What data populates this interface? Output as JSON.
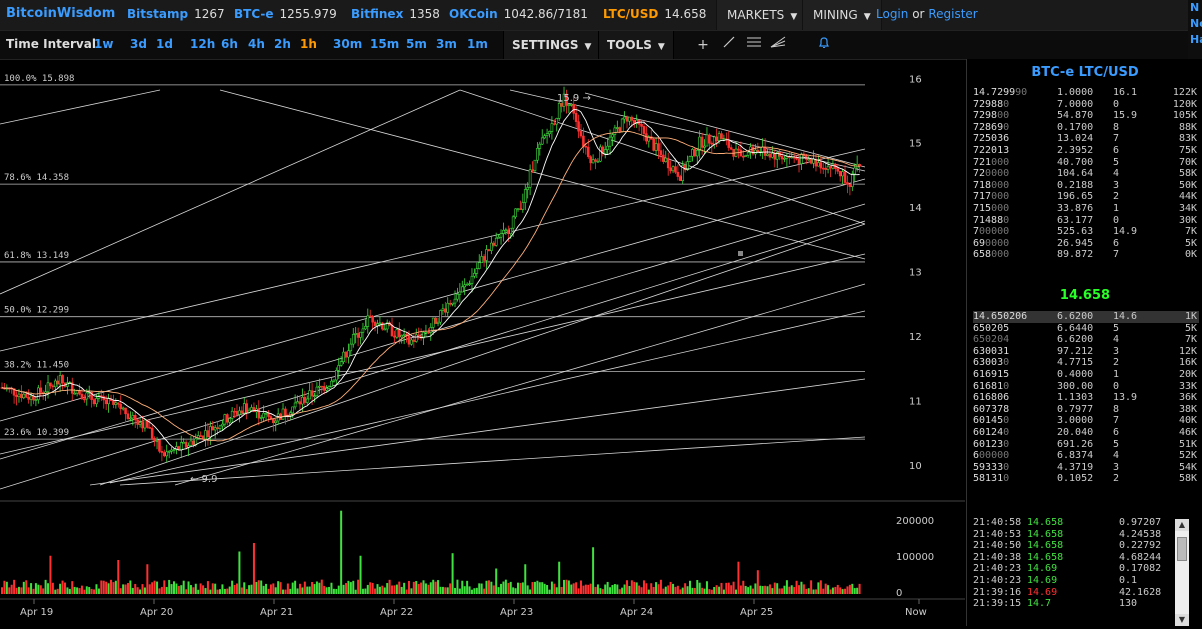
{
  "header": {
    "brand": "BitcoinWisdom",
    "tickers": [
      {
        "name": "Bitstamp",
        "value": "1267"
      },
      {
        "name": "BTC-e",
        "value": "1255.979"
      },
      {
        "name": "Bitfinex",
        "value": "1358"
      },
      {
        "name": "OKCoin",
        "value": "1042.86/7181"
      },
      {
        "name": "LTC/USD",
        "value": "14.658"
      }
    ],
    "markets_label": "MARKETS",
    "mining_label": "MINING",
    "login_label": "Login",
    "or_label": "or",
    "register_label": "Register",
    "edge_labels": [
      "N",
      "Ne",
      "Ha"
    ]
  },
  "toolbar": {
    "time_interval_label": "Time Interval:",
    "intervals": [
      "1w",
      "3d",
      "1d",
      "12h",
      "6h",
      "4h",
      "2h",
      "1h",
      "30m",
      "15m",
      "5m",
      "3m",
      "1m"
    ],
    "active_interval": "1h",
    "settings_label": "SETTINGS",
    "tools_label": "TOOLS"
  },
  "chart_data": {
    "type": "candlestick",
    "price_axis": {
      "min": 9.5,
      "max": 16.3,
      "ticks": [
        10,
        11,
        12,
        13,
        14,
        15,
        16
      ]
    },
    "volume_axis": {
      "ticks": [
        "200000",
        "100000",
        "0"
      ]
    },
    "x_labels": [
      "Apr 19",
      "Apr 20",
      "Apr 21",
      "Apr 22",
      "Apr 23",
      "Apr 24",
      "Apr 25",
      "Now"
    ],
    "fib_levels": [
      {
        "label": "100.0% 15.898",
        "value": 15.898
      },
      {
        "label": "78.6% 14.358",
        "value": 14.358
      },
      {
        "label": "61.8% 13.149",
        "value": 13.149
      },
      {
        "label": "50.0% 12.299",
        "value": 12.299
      },
      {
        "label": "38.2% 11.450",
        "value": 11.45
      },
      {
        "label": "23.6% 10.399",
        "value": 10.399
      }
    ],
    "annotations": [
      {
        "text": "15.9"
      },
      {
        "text": "9.9"
      }
    ],
    "price_anchors": [
      [
        0,
        11.2
      ],
      [
        12,
        11.05
      ],
      [
        24,
        11.3
      ],
      [
        36,
        11.05
      ],
      [
        48,
        10.9
      ],
      [
        60,
        10.6
      ],
      [
        66,
        10.15
      ],
      [
        76,
        10.3
      ],
      [
        88,
        10.6
      ],
      [
        100,
        10.9
      ],
      [
        112,
        10.7
      ],
      [
        124,
        11.0
      ],
      [
        136,
        11.3
      ],
      [
        144,
        11.9
      ],
      [
        152,
        12.3
      ],
      [
        160,
        12.1
      ],
      [
        168,
        11.9
      ],
      [
        176,
        12.1
      ],
      [
        184,
        12.5
      ],
      [
        192,
        12.8
      ],
      [
        200,
        13.3
      ],
      [
        208,
        13.6
      ],
      [
        216,
        14.2
      ],
      [
        220,
        14.8
      ],
      [
        226,
        15.2
      ],
      [
        232,
        15.7
      ],
      [
        236,
        15.5
      ],
      [
        240,
        15.0
      ],
      [
        244,
        14.7
      ],
      [
        252,
        15.1
      ],
      [
        258,
        15.4
      ],
      [
        264,
        15.2
      ],
      [
        272,
        14.8
      ],
      [
        280,
        14.5
      ],
      [
        288,
        15.0
      ],
      [
        296,
        15.1
      ],
      [
        304,
        14.8
      ],
      [
        312,
        14.9
      ],
      [
        320,
        14.8
      ],
      [
        328,
        14.75
      ],
      [
        336,
        14.7
      ],
      [
        344,
        14.6
      ],
      [
        350,
        14.4
      ],
      [
        354,
        14.65
      ]
    ],
    "volume_spikes": {
      "20": 0.45,
      "48": 0.4,
      "60": 0.35,
      "98": 0.5,
      "104": 0.6,
      "140": 0.98,
      "148": 0.45,
      "186": 0.48,
      "204": 0.3,
      "216": 0.35,
      "230": 0.38,
      "244": 0.55,
      "304": 0.38,
      "312": 0.28
    }
  },
  "orderbook": {
    "title": "BTC-e LTC/USD",
    "asks": [
      {
        "price": "14.7299",
        "dim": "90",
        "amount": "1.0000",
        "sum": "16.1",
        "vol": "122K"
      },
      {
        "price": "72988",
        "dim": "0",
        "amount": "7.0000",
        "sum": "0",
        "vol": "120K"
      },
      {
        "price": "7298",
        "dim": "00",
        "amount": "54.870",
        "sum": "15.9",
        "vol": "105K"
      },
      {
        "price": "72869",
        "dim": "0",
        "amount": "0.1700",
        "sum": "8",
        "vol": "88K"
      },
      {
        "price": "725036",
        "dim": "",
        "amount": "13.024",
        "sum": "7",
        "vol": "83K"
      },
      {
        "price": "722013",
        "dim": "",
        "amount": "2.3952",
        "sum": "6",
        "vol": "75K"
      },
      {
        "price": "721",
        "dim": "000",
        "amount": "40.700",
        "sum": "5",
        "vol": "70K"
      },
      {
        "price": "72",
        "dim": "0000",
        "amount": "104.64",
        "sum": "4",
        "vol": "58K"
      },
      {
        "price": "718",
        "dim": "000",
        "amount": "0.2188",
        "sum": "3",
        "vol": "50K"
      },
      {
        "price": "717",
        "dim": "000",
        "amount": "196.65",
        "sum": "2",
        "vol": "44K"
      },
      {
        "price": "715",
        "dim": "000",
        "amount": "33.876",
        "sum": "1",
        "vol": "34K"
      },
      {
        "price": "71488",
        "dim": "0",
        "amount": "63.177",
        "sum": "0",
        "vol": "30K"
      },
      {
        "price": "7",
        "dim": "00000",
        "amount": "525.63",
        "sum": "14.9",
        "vol": "7K"
      },
      {
        "price": "69",
        "dim": "0000",
        "amount": "26.945",
        "sum": "6",
        "vol": "5K"
      },
      {
        "price": "658",
        "dim": "000",
        "amount": "89.872",
        "sum": "7",
        "vol": "0K"
      }
    ],
    "last_price": "14.658",
    "bids": [
      {
        "price": "14.650206",
        "dim": "",
        "amount": "6.6200",
        "sum": "14.6",
        "vol": "1K"
      },
      {
        "price": "650205",
        "dim": "",
        "amount": "6.6440",
        "sum": "5",
        "vol": "5K"
      },
      {
        "price": "",
        "dim": "650204",
        "amount": "6.6200",
        "sum": "4",
        "vol": "7K"
      },
      {
        "price": "630031",
        "dim": "",
        "amount": "97.212",
        "sum": "3",
        "vol": "12K"
      },
      {
        "price": "63003",
        "dim": "0",
        "amount": "4.7715",
        "sum": "2",
        "vol": "16K"
      },
      {
        "price": "616915",
        "dim": "",
        "amount": "0.4000",
        "sum": "1",
        "vol": "20K"
      },
      {
        "price": "61681",
        "dim": "0",
        "amount": "300.00",
        "sum": "0",
        "vol": "33K"
      },
      {
        "price": "616806",
        "dim": "",
        "amount": "1.1303",
        "sum": "13.9",
        "vol": "36K"
      },
      {
        "price": "607378",
        "dim": "",
        "amount": "0.7977",
        "sum": "8",
        "vol": "38K"
      },
      {
        "price": "60145",
        "dim": "0",
        "amount": "3.0000",
        "sum": "7",
        "vol": "40K"
      },
      {
        "price": "60124",
        "dim": "0",
        "amount": "20.040",
        "sum": "6",
        "vol": "46K"
      },
      {
        "price": "60123",
        "dim": "0",
        "amount": "691.26",
        "sum": "5",
        "vol": "51K"
      },
      {
        "price": "6",
        "dim": "00000",
        "amount": "6.8374",
        "sum": "4",
        "vol": "52K"
      },
      {
        "price": "59333",
        "dim": "0",
        "amount": "4.3719",
        "sum": "3",
        "vol": "54K"
      },
      {
        "price": "58131",
        "dim": "0",
        "amount": "0.1052",
        "sum": "2",
        "vol": "58K"
      }
    ]
  },
  "trades": [
    {
      "time": "21:40:58",
      "price": "14.658",
      "amount": "0.97207",
      "side": "buy"
    },
    {
      "time": "21:40:53",
      "price": "14.658",
      "amount": "4.24538",
      "side": "buy"
    },
    {
      "time": "21:40:50",
      "price": "14.658",
      "amount": "0.22792",
      "side": "buy"
    },
    {
      "time": "21:40:38",
      "price": "14.658",
      "amount": "4.68244",
      "side": "buy"
    },
    {
      "time": "21:40:23",
      "price": "14.69",
      "amount": "0.17082",
      "side": "buy"
    },
    {
      "time": "21:40:23",
      "price": "14.69",
      "amount": "0.1",
      "side": "buy"
    },
    {
      "time": "21:39:16",
      "price": "14.69",
      "amount": "42.1628",
      "side": "sell"
    },
    {
      "time": "21:39:15",
      "price": "14.7",
      "amount": "130",
      "side": "buy"
    }
  ],
  "colors": {
    "accent": "#3b9cff",
    "active": "#ff9a00",
    "up": "#3fe23f",
    "down": "#ff3030",
    "last": "#28ff28"
  }
}
